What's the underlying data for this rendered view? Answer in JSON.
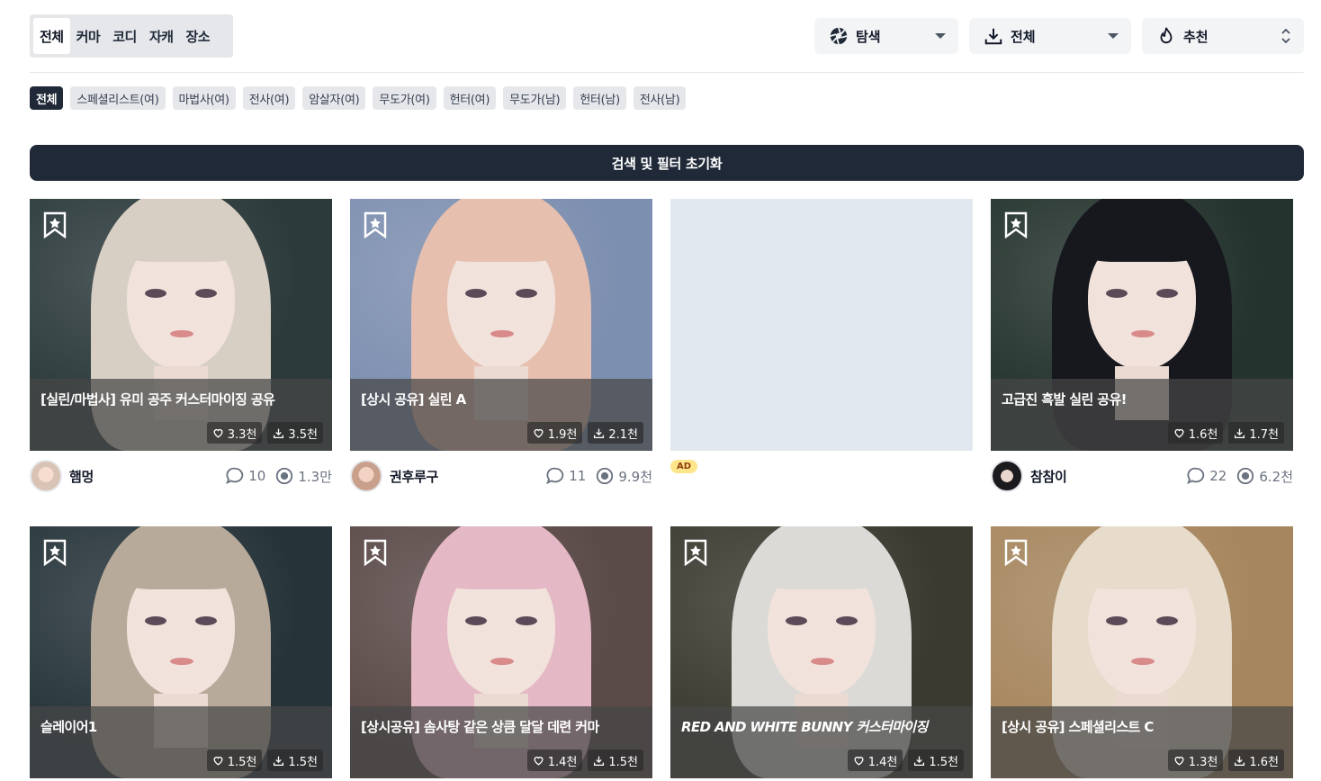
{
  "top_tabs": [
    {
      "label": "전체",
      "active": true
    },
    {
      "label": "커마",
      "active": false
    },
    {
      "label": "코디",
      "active": false
    },
    {
      "label": "자캐",
      "active": false
    },
    {
      "label": "장소",
      "active": false
    }
  ],
  "dropdowns": {
    "explore": {
      "label": "탐색",
      "icon": "aperture-icon"
    },
    "download": {
      "label": "전체",
      "icon": "download-icon"
    },
    "sort": {
      "label": "추천",
      "icon": "flame-icon"
    }
  },
  "chips": [
    {
      "label": "전체",
      "active": true
    },
    {
      "label": "스페셜리스트(여)"
    },
    {
      "label": "마법사(여)"
    },
    {
      "label": "전사(여)"
    },
    {
      "label": "암살자(여)"
    },
    {
      "label": "무도가(여)"
    },
    {
      "label": "헌터(여)"
    },
    {
      "label": "무도가(남)"
    },
    {
      "label": "헌터(남)"
    },
    {
      "label": "전사(남)"
    }
  ],
  "reset_button": "검색 및 필터 초기화",
  "ad_badge": "AD",
  "cards": [
    {
      "title": "[실린/마법사] 유미 공주 커스터마이징 공유",
      "likes": "3.3천",
      "downloads": "3.5천",
      "author": "햄멍",
      "comments": "10",
      "views": "1.3만",
      "hair": "#d8cfc4",
      "bg": "#2c3a3c"
    },
    {
      "title": "[상시 공유] 실린 A",
      "likes": "1.9천",
      "downloads": "2.1천",
      "author": "권후루구",
      "comments": "11",
      "views": "9.9천",
      "hair": "#e6bfae",
      "bg": "#7d8fb0"
    },
    {
      "title": "고급진 흑발 실린 공유!",
      "likes": "1.6천",
      "downloads": "1.7천",
      "author": "참참이",
      "comments": "22",
      "views": "6.2천",
      "hair": "#16181d",
      "bg": "#24332d"
    },
    {
      "title": "슬레이어1",
      "likes": "1.5천",
      "downloads": "1.5천",
      "hair": "#b8aa9a",
      "bg": "#26343a"
    },
    {
      "title": "[상시공유] 솜사탕 같은 상큼 달달 데련 커마",
      "likes": "1.4천",
      "downloads": "1.5천",
      "hair": "#e4b8c4",
      "bg": "#5a4a48"
    },
    {
      "title": "RED AND WHITE BUNNY 커스터마이징",
      "likes": "1.4천",
      "downloads": "1.5천",
      "hair": "#dcdad6",
      "bg": "#3b3a30"
    },
    {
      "title": "[상시 공유] 스페셜리스트 C",
      "likes": "1.3천",
      "downloads": "1.6천",
      "hair": "#e7dccb",
      "bg": "#a6865e"
    }
  ]
}
